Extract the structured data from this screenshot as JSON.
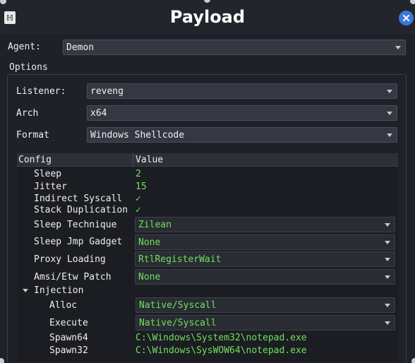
{
  "window": {
    "title": "Payload",
    "logo_glyph": "ℍ"
  },
  "agent": {
    "label": "Agent:",
    "value": "Demon"
  },
  "options": {
    "label": "Options",
    "listener": {
      "label": "Listener:",
      "value": "reveng"
    },
    "arch": {
      "label": "Arch",
      "value": "x64"
    },
    "format": {
      "label": "Format",
      "value": "Windows Shellcode"
    }
  },
  "config": {
    "col_config": "Config",
    "col_value": "Value",
    "sleep": {
      "label": "Sleep",
      "value": "2"
    },
    "jitter": {
      "label": "Jitter",
      "value": "15"
    },
    "indirect_syscall": {
      "label": "Indirect Syscall",
      "value": "✓"
    },
    "stack_duplication": {
      "label": "Stack Duplication",
      "value": "✓"
    },
    "sleep_technique": {
      "label": "Sleep Technique",
      "value": "Zilean"
    },
    "sleep_jmp_gadget": {
      "label": "Sleep Jmp Gadget",
      "value": "None"
    },
    "proxy_loading": {
      "label": "Proxy Loading",
      "value": "RtlRegisterWait"
    },
    "amsi_etw_patch": {
      "label": "Amsi/Etw Patch",
      "value": "None"
    },
    "injection": {
      "label": "Injection",
      "alloc": {
        "label": "Alloc",
        "value": "Native/Syscall"
      },
      "execute": {
        "label": "Execute",
        "value": "Native/Syscall"
      },
      "spawn64": {
        "label": "Spawn64",
        "value": "C:\\Windows\\System32\\notepad.exe"
      },
      "spawn32": {
        "label": "Spawn32",
        "value": "C:\\Windows\\SysWOW64\\notepad.exe"
      }
    }
  },
  "colors": {
    "accent_green": "#6fe05b",
    "close_blue": "#3a78d8",
    "background": "#1f2128"
  }
}
